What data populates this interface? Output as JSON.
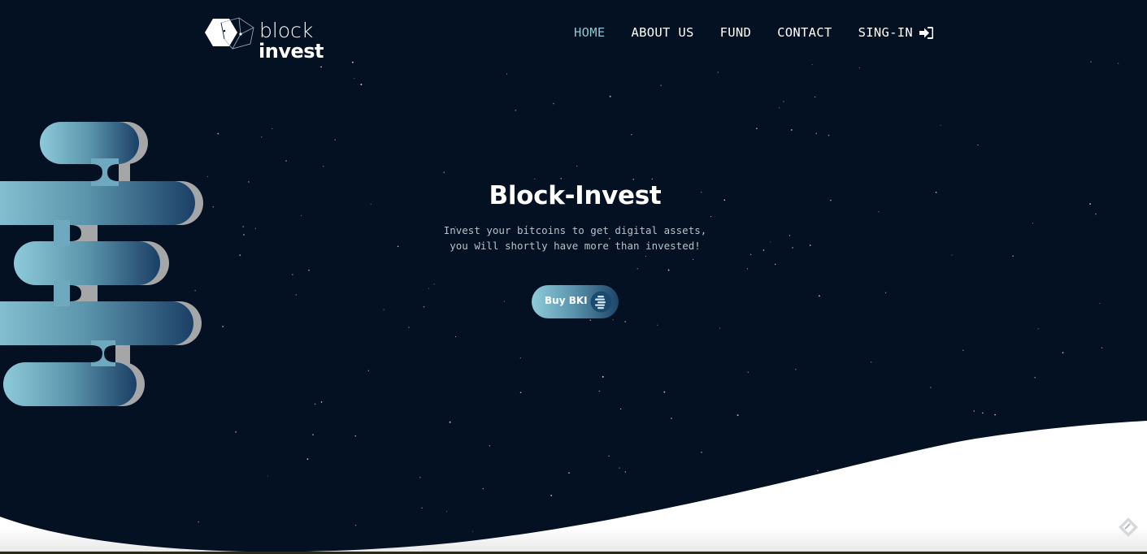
{
  "header": {
    "logo": {
      "line1": "block",
      "line2": "invest",
      "icon": "hexagon-cube-logo-icon"
    },
    "nav": [
      {
        "label": "HOME",
        "active": true
      },
      {
        "label": "ABOUT US",
        "active": false
      },
      {
        "label": "FUND",
        "active": false
      },
      {
        "label": "CONTACT",
        "active": false
      },
      {
        "label": "SING-IN",
        "active": false,
        "icon": "sign-in-icon"
      }
    ]
  },
  "hero": {
    "title": "Block-Invest",
    "subtitle_line1": "Invest your bitcoins to get digital assets,",
    "subtitle_line2": "you will shortly have more than invested!",
    "button": {
      "label": "Buy BKI",
      "icon": "bki-coin-icon"
    }
  },
  "decor": {
    "blob": "gradient-capsule-stack-illustration",
    "corner": "diamond-scroll-icon"
  },
  "colors": {
    "background": "#031122",
    "accent": "#8cc6d3",
    "gradient_start": "#8ecbd9",
    "gradient_end": "#1f4468",
    "text": "#ffffff",
    "wave": "#ffffff"
  }
}
